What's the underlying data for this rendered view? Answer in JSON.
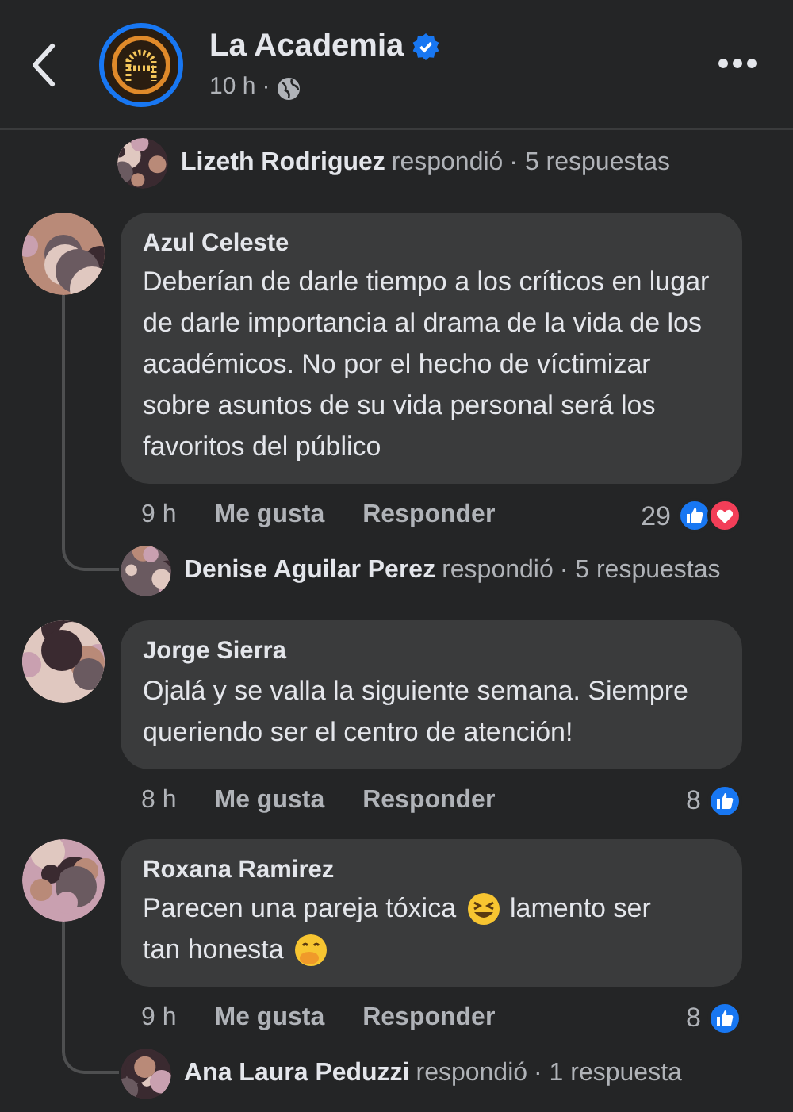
{
  "header": {
    "page_name": "La Academia",
    "verified": true,
    "time": "10 h",
    "separator": "·"
  },
  "comments": [
    {
      "kind": "reply_summary",
      "name": "Lizeth Rodriguez",
      "action": "respondió",
      "count": "· 5 respuestas"
    },
    {
      "kind": "comment",
      "name": "Azul Celeste",
      "thread": true,
      "body": [
        {
          "kind": "text",
          "text": "Deberían de darle tiempo a los críticos en lugar de darle importancia al drama de la vida de los académicos. No por el hecho de víctimizar sobre asuntos de su vida personal será los favoritos del público"
        }
      ],
      "time": "9 h",
      "like": "Me gusta",
      "reply": "Responder",
      "reaction_count": "29",
      "reactions": [
        {
          "kind": "like"
        },
        {
          "kind": "love"
        }
      ],
      "replies": {
        "name": "Denise Aguilar Perez",
        "action": "respondió",
        "count": "· 5 respuestas"
      }
    },
    {
      "kind": "comment",
      "name": "Jorge Sierra",
      "thread": false,
      "body": [
        {
          "kind": "text",
          "text": "Ojalá y se valla la siguiente semana. Siempre queriendo ser el centro de atención!"
        }
      ],
      "time": "8 h",
      "like": "Me gusta",
      "reply": "Responder",
      "reaction_count": "8",
      "reactions": [
        {
          "kind": "like"
        }
      ]
    },
    {
      "kind": "comment",
      "name": "Roxana Ramirez",
      "thread": true,
      "body": [
        {
          "kind": "text",
          "text": "Parecen una pareja tóxica"
        },
        {
          "kind": "laughing_emoji"
        },
        {
          "kind": "text",
          "text": "lamento ser"
        },
        {
          "kind": "text",
          "text": "tan honesta"
        },
        {
          "kind": "hand_over_mouth_emoji"
        }
      ],
      "time": "9 h",
      "like": "Me gusta",
      "reply": "Responder",
      "reaction_count": "8",
      "reactions": [
        {
          "kind": "like"
        }
      ],
      "replies": {
        "name": "Ana Laura Peduzzi",
        "action": "respondió",
        "count": "· 1 respuesta"
      }
    }
  ]
}
